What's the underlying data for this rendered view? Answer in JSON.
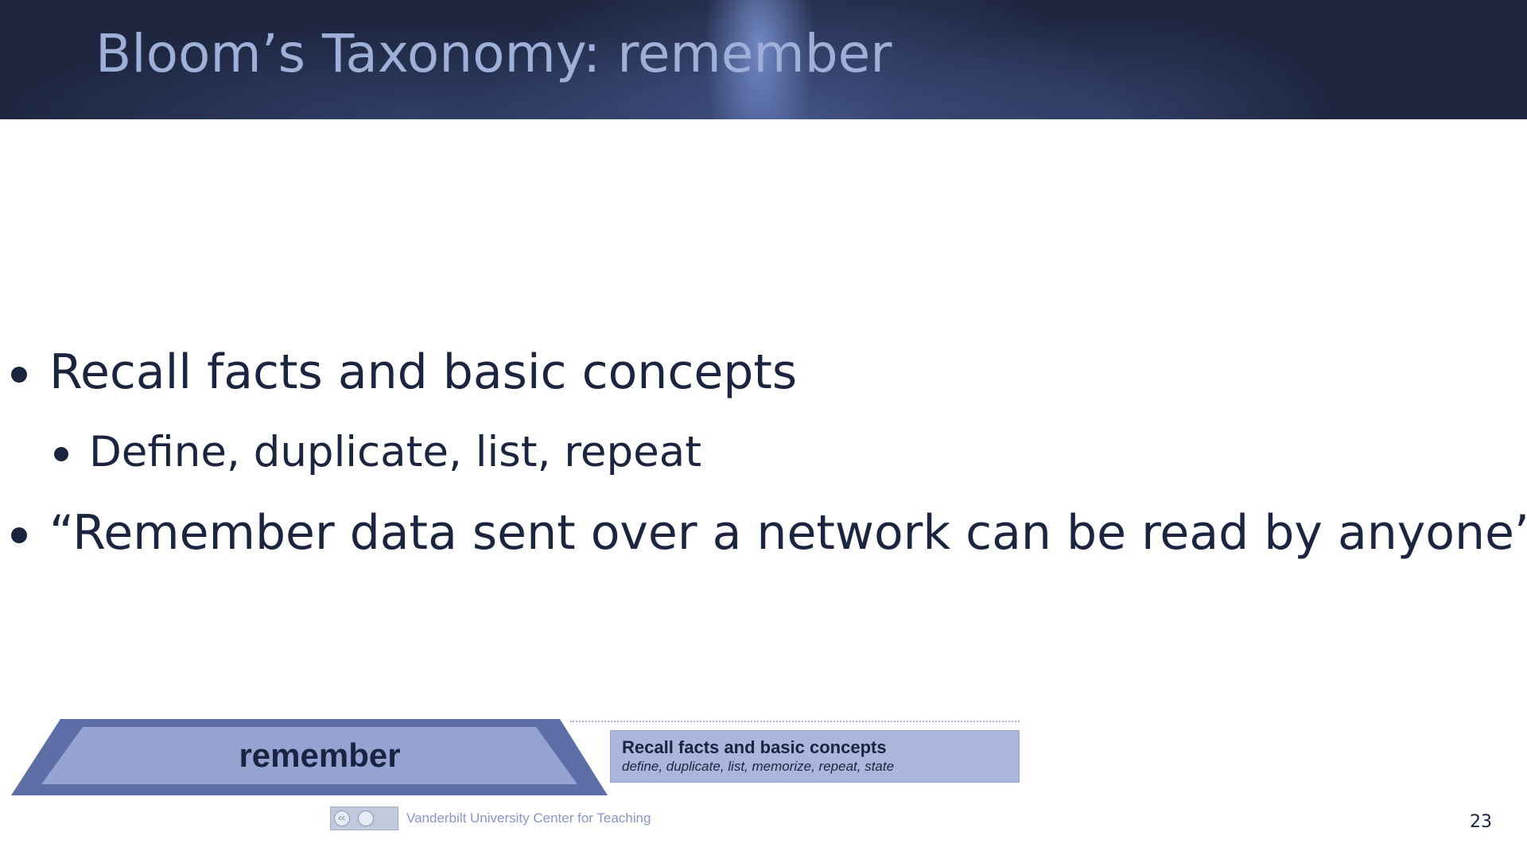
{
  "slide": {
    "title": "Bloom’s Taxonomy: remember",
    "bullets": [
      {
        "text": "Recall facts and basic concepts",
        "level": 1
      },
      {
        "text": "Define, duplicate, list, repeat",
        "level": 2
      },
      {
        "text": "“Remember data sent over a network can be read by anyone”",
        "level": 1
      }
    ],
    "page_number": "23"
  },
  "bloom_graphic": {
    "level_label": "remember",
    "description_title": "Recall facts and basic concepts",
    "description_verbs": "define, duplicate, list, memorize, repeat, state",
    "license_icon": "cc-by-icon",
    "license_text": "cc",
    "credit": "Vanderbilt University Center for Teaching"
  },
  "colors": {
    "header_background": "#1e2640",
    "title_text": "#9fb0d8",
    "body_text": "#1c2540",
    "trapezoid_outer": "#5d6ea6",
    "trapezoid_inner": "#95a3d2",
    "description_box": "#aab6dc"
  }
}
